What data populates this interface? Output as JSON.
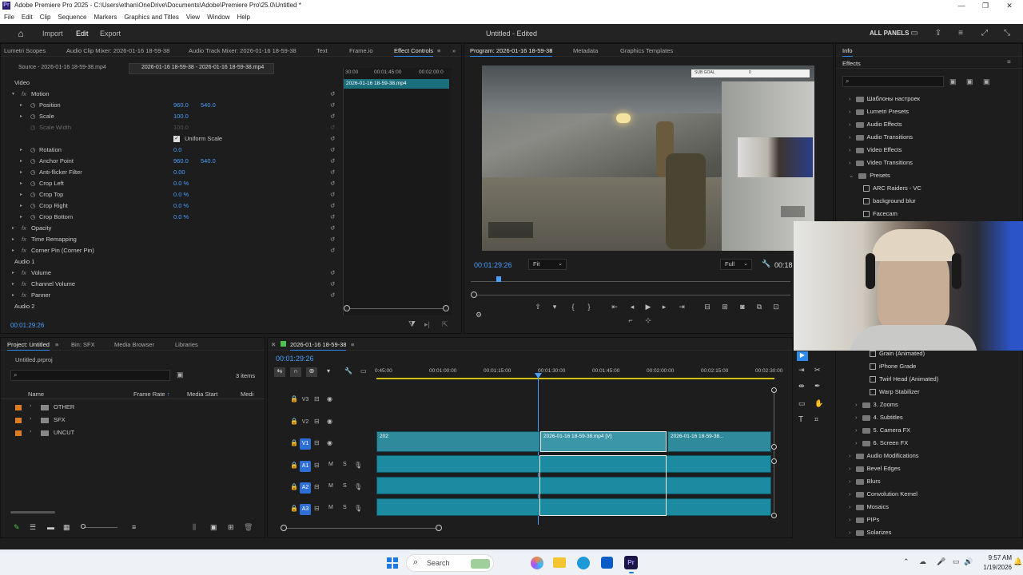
{
  "window": {
    "title": "Adobe Premiere Pro 2025 - C:\\Users\\ethan\\OneDrive\\Documents\\Adobe\\Premiere Pro\\25.0\\Untitled *"
  },
  "menu": [
    "File",
    "Edit",
    "Clip",
    "Sequence",
    "Markers",
    "Graphics and Titles",
    "View",
    "Window",
    "Help"
  ],
  "header": {
    "import": "Import",
    "edit": "Edit",
    "export": "Export",
    "doc_title": "Untitled - Edited",
    "all_panels": "ALL PANELS"
  },
  "upper_tabs": [
    "Lumetri Scopes",
    "Audio Clip Mixer: 2026-01-16 18-59-38",
    "Audio Track Mixer: 2026-01-16 18-59-38",
    "Text",
    "Frame.io",
    "Effect Controls"
  ],
  "ec": {
    "source_tab": "Source - 2026-01-16 18-59-38.mp4",
    "clip_tab": "2026-01-16 18-59-38 - 2026-01-16 18-59-38.mp4",
    "mini_time1": "30:00",
    "mini_time2": "00:01:45:00",
    "mini_time3": "00:02:00:0",
    "mini_clip": "2026-01-16 18-59-38.mp4",
    "current_time": "00:01:29:26",
    "rows": [
      {
        "label": "Video",
        "indent": 0,
        "type": "section"
      },
      {
        "label": "Motion",
        "indent": 1,
        "type": "fx"
      },
      {
        "label": "Position",
        "indent": 2,
        "v1": "960.0",
        "v2": "540.0"
      },
      {
        "label": "Scale",
        "indent": 2,
        "v1": "100.0"
      },
      {
        "label": "Scale Width",
        "indent": 2,
        "v1": "100.0",
        "dim": true
      },
      {
        "label": "Uniform Scale",
        "indent": 3,
        "checkbox": true
      },
      {
        "label": "Rotation",
        "indent": 2,
        "v1": "0.0"
      },
      {
        "label": "Anchor Point",
        "indent": 2,
        "v1": "960.0",
        "v2": "540.0"
      },
      {
        "label": "Anti-flicker Filter",
        "indent": 2,
        "v1": "0.00"
      },
      {
        "label": "Crop Left",
        "indent": 2,
        "v1": "0.0 %"
      },
      {
        "label": "Crop Top",
        "indent": 2,
        "v1": "0.0 %"
      },
      {
        "label": "Crop Right",
        "indent": 2,
        "v1": "0.0 %"
      },
      {
        "label": "Crop Bottom",
        "indent": 2,
        "v1": "0.0 %"
      },
      {
        "label": "Opacity",
        "indent": 1,
        "type": "fx"
      },
      {
        "label": "Time Remapping",
        "indent": 1,
        "type": "fx"
      },
      {
        "label": "Corner Pin (Corner Pin)",
        "indent": 1,
        "type": "fx"
      },
      {
        "label": "Audio 1",
        "indent": 0,
        "type": "section"
      },
      {
        "label": "Volume",
        "indent": 1,
        "type": "fx"
      },
      {
        "label": "Channel Volume",
        "indent": 1,
        "type": "fx"
      },
      {
        "label": "Panner",
        "indent": 1,
        "type": "fx"
      },
      {
        "label": "Audio 2",
        "indent": 0,
        "type": "section"
      }
    ]
  },
  "program": {
    "title": "Program: 2026-01-16 18-59-38",
    "tab2": "Metadata",
    "tab3": "Graphics Templates",
    "timecode": "00:01:29:26",
    "fit": "Fit",
    "full": "Full",
    "right_time": "00:18",
    "overlay_label": "SUB GOAL",
    "overlay_val": "0"
  },
  "info": {
    "tab": "Info",
    "effects_title": "Effects"
  },
  "effects_tree": [
    {
      "label": "Шаблоны настроек",
      "lvl": 0,
      "kind": "folder"
    },
    {
      "label": "Lumetri Presets",
      "lvl": 0,
      "kind": "folder"
    },
    {
      "label": "Audio Effects",
      "lvl": 0,
      "kind": "folder"
    },
    {
      "label": "Audio Transitions",
      "lvl": 0,
      "kind": "folder"
    },
    {
      "label": "Video Effects",
      "lvl": 0,
      "kind": "folder"
    },
    {
      "label": "Video Transitions",
      "lvl": 0,
      "kind": "folder"
    },
    {
      "label": "Presets",
      "lvl": 0,
      "kind": "folder",
      "open": true
    },
    {
      "label": "ARC Raiders - VC",
      "lvl": 1,
      "kind": "preset"
    },
    {
      "label": "background blur",
      "lvl": 1,
      "kind": "preset"
    },
    {
      "label": "Facecam",
      "lvl": 1,
      "kind": "preset"
    }
  ],
  "effects_tree2": [
    {
      "label": "Grain (Animated)",
      "lvl": 2,
      "kind": "preset"
    },
    {
      "label": "iPhone Grade",
      "lvl": 2,
      "kind": "preset"
    },
    {
      "label": "Twirl Head (Animated)",
      "lvl": 2,
      "kind": "preset"
    },
    {
      "label": "Warp Stabilizer",
      "lvl": 2,
      "kind": "preset"
    },
    {
      "label": "3. Zooms",
      "lvl": 1,
      "kind": "folder"
    },
    {
      "label": "4. Subtitles",
      "lvl": 1,
      "kind": "folder"
    },
    {
      "label": "5. Camera FX",
      "lvl": 1,
      "kind": "folder"
    },
    {
      "label": "6. Screen FX",
      "lvl": 1,
      "kind": "folder"
    },
    {
      "label": "Audio Modifications",
      "lvl": 0,
      "kind": "folder"
    },
    {
      "label": "Bevel Edges",
      "lvl": 0,
      "kind": "folder"
    },
    {
      "label": "Blurs",
      "lvl": 0,
      "kind": "folder"
    },
    {
      "label": "Convolution Kernel",
      "lvl": 0,
      "kind": "folder"
    },
    {
      "label": "Mosaics",
      "lvl": 0,
      "kind": "folder"
    },
    {
      "label": "PIPs",
      "lvl": 0,
      "kind": "folder"
    },
    {
      "label": "Solarizes",
      "lvl": 0,
      "kind": "folder"
    }
  ],
  "project": {
    "tabs": [
      "Project: Untitled",
      "Bin: SFX",
      "Media Browser",
      "Libraries"
    ],
    "file": "Untitled.prproj",
    "count": "3 items",
    "cols": [
      "Name",
      "Frame Rate",
      "Media Start",
      "Medi"
    ],
    "items": [
      {
        "name": "OTHER",
        "color": "#e07b20"
      },
      {
        "name": "SFX",
        "color": "#e07b20"
      },
      {
        "name": "UNCUT",
        "color": "#e07b20"
      }
    ]
  },
  "timeline": {
    "title": "2026-01-16 18-59-38",
    "timecode": "00:01:29:26",
    "ruler": [
      "0:45:00",
      "00:01:00:00",
      "00:01:15:00",
      "00:01:30:00",
      "00:01:45:00",
      "00:02:00:00",
      "00:02:15:00",
      "00:02:30:00"
    ],
    "tracks": [
      "V3",
      "V2",
      "V1",
      "A1",
      "A2",
      "A3"
    ],
    "clip1": "202",
    "clip2": "2026-01-16 18-59-38.mp4 [V]",
    "clip3": "2026-01-16 18-59-38..."
  },
  "taskbar": {
    "search": "Search",
    "time": "9:57 AM",
    "date": "1/19/2026"
  }
}
